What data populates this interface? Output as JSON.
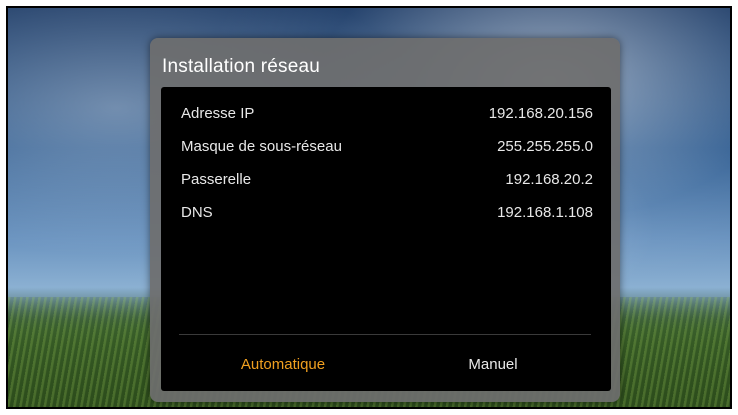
{
  "dialog": {
    "title": "Installation réseau"
  },
  "network": {
    "rows": [
      {
        "label": "Adresse IP",
        "value": "192.168.20.156"
      },
      {
        "label": "Masque de sous-réseau",
        "value": "255.255.255.0"
      },
      {
        "label": "Passerelle",
        "value": "192.168.20.2"
      },
      {
        "label": "DNS",
        "value": "192.168.1.108"
      }
    ]
  },
  "options": {
    "automatic": "Automatique",
    "manual": "Manuel",
    "selected": "Automatique"
  },
  "colors": {
    "accent": "#f0a020",
    "text": "#e8e8e8",
    "panel": "#000000",
    "dialog": "#6e6e6e"
  }
}
